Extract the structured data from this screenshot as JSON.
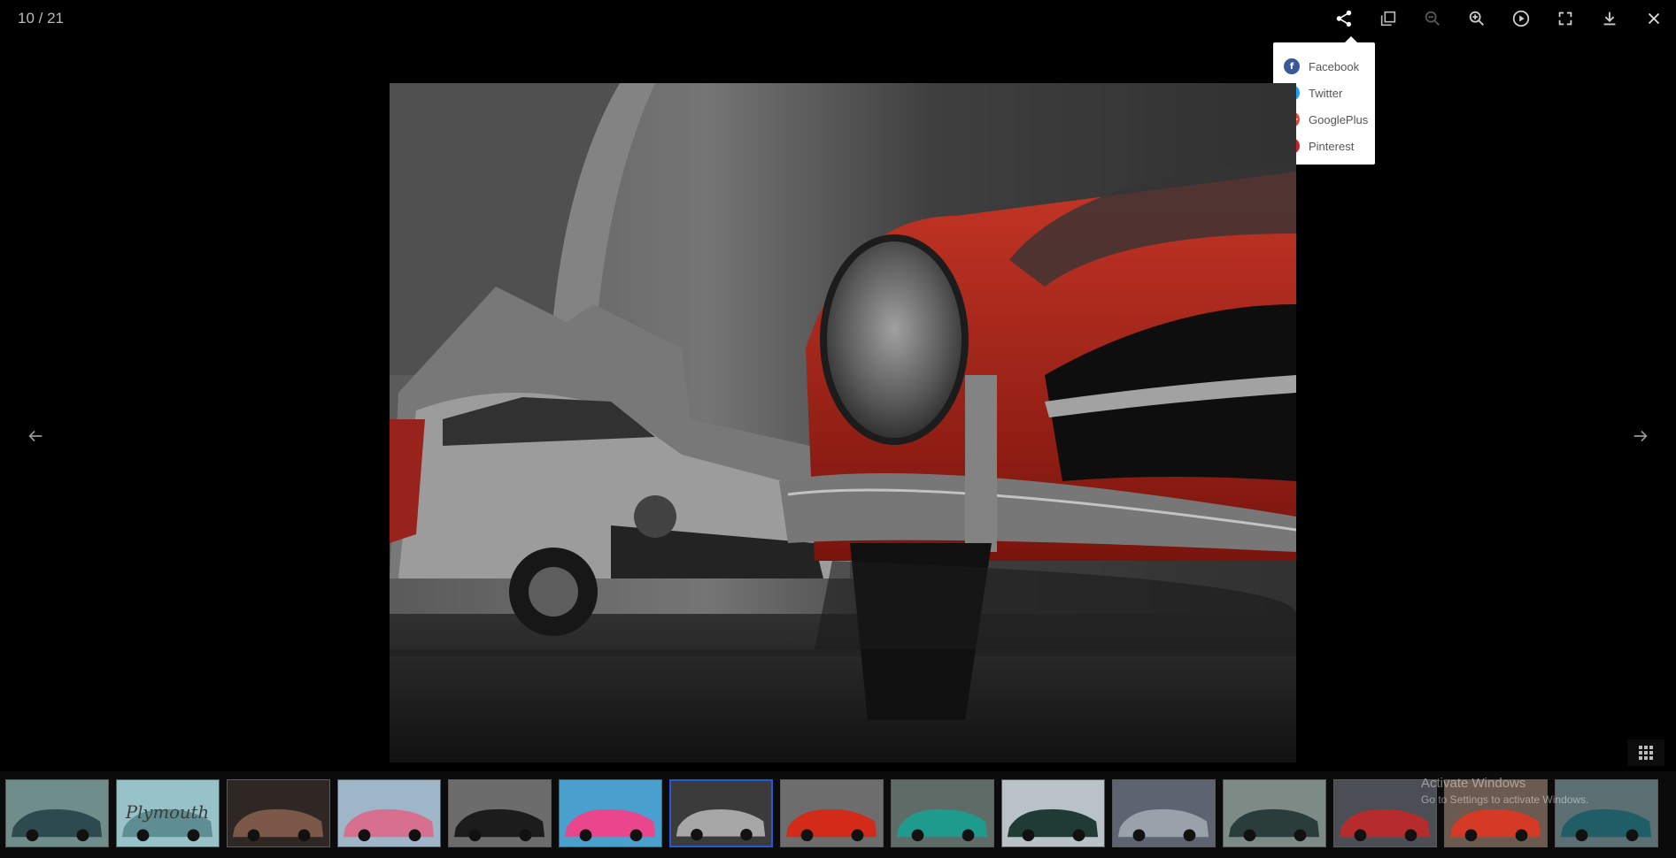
{
  "counter": {
    "current": "10",
    "separator": " / ",
    "total": "21"
  },
  "toolbar": {
    "tools": [
      {
        "name": "share-button",
        "icon": "share-icon",
        "active": true
      },
      {
        "name": "thumbnail-button",
        "icon": "copy-icon",
        "active": false
      },
      {
        "name": "zoom-out-button",
        "icon": "zoom-out-icon",
        "active": false,
        "disabled": true
      },
      {
        "name": "zoom-in-button",
        "icon": "zoom-in-icon",
        "active": false
      },
      {
        "name": "autoplay-button",
        "icon": "play-icon",
        "active": false
      },
      {
        "name": "fullscreen-button",
        "icon": "fullscreen-icon",
        "active": false
      },
      {
        "name": "download-button",
        "icon": "download-icon",
        "active": false
      },
      {
        "name": "close-button",
        "icon": "close-icon",
        "active": false
      }
    ]
  },
  "share_menu": {
    "items": [
      {
        "label": "Facebook",
        "badge": "f",
        "color": "#3b5998"
      },
      {
        "label": "Twitter",
        "badge": "t",
        "color": "#1da1f2"
      },
      {
        "label": "GooglePlus",
        "badge": "g+",
        "color": "#dd4b39"
      },
      {
        "label": "Pinterest",
        "badge": "p",
        "color": "#cb2027"
      }
    ]
  },
  "nav": {
    "prev_icon": "arrow-left-icon",
    "next_icon": "arrow-right-icon"
  },
  "grid_toggle": {
    "icon": "grid-icon"
  },
  "thumbnails": {
    "active_index": 7,
    "items": [
      {
        "tone": "#7a4a3a",
        "accent": "#c0392b"
      },
      {
        "tone": "#6f8d8a",
        "accent": "#2d4b4e"
      },
      {
        "tone": "#97c3c8",
        "accent": "#5e8d93",
        "caption": "Plymouth"
      },
      {
        "tone": "#2e2724",
        "accent": "#7b5847"
      },
      {
        "tone": "#9fb6c9",
        "accent": "#d7708f"
      },
      {
        "tone": "#6c6c6c",
        "accent": "#1c1c1c"
      },
      {
        "tone": "#4aa0cd",
        "accent": "#e9468b"
      },
      {
        "tone": "#3b3b3b",
        "accent": "#a6a6a6"
      },
      {
        "tone": "#6d6d6d",
        "accent": "#d22b1a"
      },
      {
        "tone": "#5f6b67",
        "accent": "#1f9b8e"
      },
      {
        "tone": "#b9c2c7",
        "accent": "#203b33"
      },
      {
        "tone": "#5d6470",
        "accent": "#9ba1ab"
      },
      {
        "tone": "#7d8a86",
        "accent": "#2a3d3a"
      },
      {
        "tone": "#4b4f55",
        "accent": "#b62c2c"
      },
      {
        "tone": "#6a5a4f",
        "accent": "#d53a26"
      },
      {
        "tone": "#5c6f73",
        "accent": "#1f5e66"
      }
    ]
  },
  "watermark": {
    "line1": "Activate Windows",
    "line2": "Go to Settings to activate Windows."
  },
  "colors": {
    "background": "#000000",
    "active_thumb_border": "#1e5bd6",
    "car_red": "#d9261a"
  }
}
